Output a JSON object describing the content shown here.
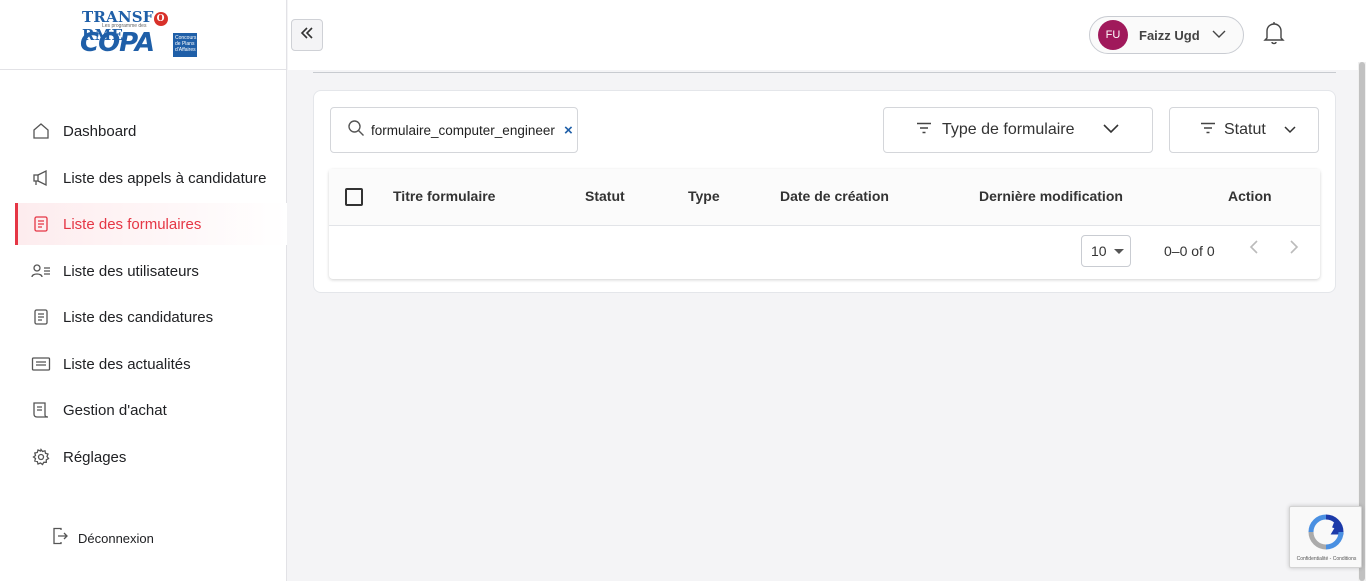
{
  "brand": {
    "line1_left": "TRANSF",
    "line1_circle": "O",
    "line1_right": "RME",
    "tagline": "Les programme des",
    "line2": "COPA",
    "badge": "Concours de Plans d'Affaires"
  },
  "sidebar": {
    "items": [
      {
        "label": "Dashboard",
        "icon": "home-icon"
      },
      {
        "label": "Liste des appels à candidature",
        "icon": "megaphone-icon"
      },
      {
        "label": "Liste des formulaires",
        "icon": "form-icon",
        "active": true
      },
      {
        "label": "Liste des utilisateurs",
        "icon": "users-icon"
      },
      {
        "label": "Liste des candidatures",
        "icon": "document-icon"
      },
      {
        "label": "Liste des actualités",
        "icon": "news-icon"
      },
      {
        "label": "Gestion d'achat",
        "icon": "receipt-icon"
      },
      {
        "label": "Réglages",
        "icon": "gear-icon"
      }
    ],
    "logout_label": "Déconnexion"
  },
  "user": {
    "initials": "FU",
    "name": "Faizz Ugd"
  },
  "search": {
    "value": "formulaire_computer_engineer",
    "clear": "×"
  },
  "filters": {
    "type_label": "Type de formulaire",
    "statut_label": "Statut"
  },
  "table": {
    "columns": [
      "Titre formulaire",
      "Statut",
      "Type",
      "Date de création",
      "Dernière modification",
      "Action"
    ],
    "rows": []
  },
  "pagination": {
    "rows_per_page": "10",
    "range": "0–0 of 0"
  },
  "recaptcha": {
    "label": "Confidentialité - Conditions"
  },
  "colors": {
    "accent": "#e53645",
    "brand_blue": "#1f5fa8",
    "avatar": "#a0195b"
  }
}
